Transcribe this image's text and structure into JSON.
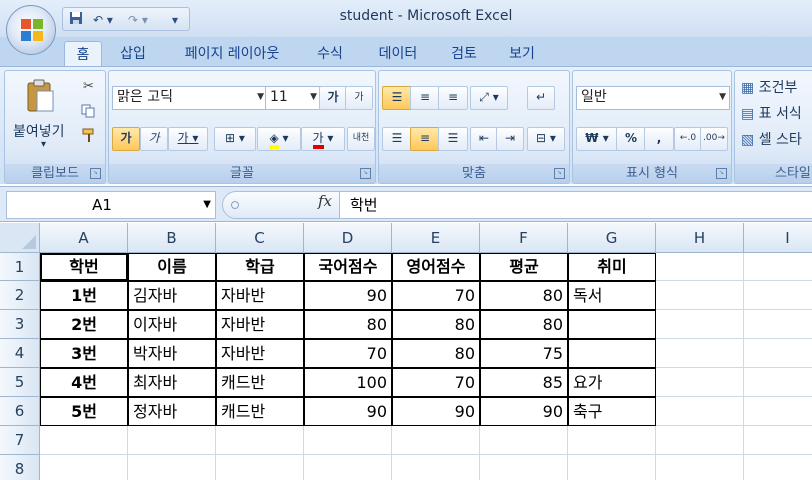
{
  "window": {
    "title": "student - Microsoft Excel"
  },
  "ribbon": {
    "tabs": [
      "홈",
      "삽입",
      "페이지 레이아웃",
      "수식",
      "데이터",
      "검토",
      "보기"
    ],
    "active_tab": "홈",
    "clipboard": {
      "paste_label": "붙여넣기",
      "group_label": "클립보드"
    },
    "font": {
      "name": "맑은 고딕",
      "size": "11",
      "group_label": "글꼴",
      "bold": "가",
      "italic": "가",
      "underline": "가",
      "grow": "가",
      "shrink": "가",
      "color_letter": "가",
      "phonetic": "내천"
    },
    "alignment": {
      "group_label": "맞춤"
    },
    "number": {
      "format": "일반",
      "group_label": "표시 형식",
      "currency": "₩",
      "percent": "%",
      "comma": ","
    },
    "styles": {
      "items": [
        "조건부",
        "표 서식",
        "셀 스타"
      ],
      "group_label": "스타일"
    }
  },
  "formula_bar": {
    "name_box": "A1",
    "fx": "fx",
    "content": "학번"
  },
  "sheet": {
    "columns": [
      "A",
      "B",
      "C",
      "D",
      "E",
      "F",
      "G",
      "H",
      "I"
    ],
    "rows": [
      "1",
      "2",
      "3",
      "4",
      "5",
      "6",
      "7",
      "8"
    ],
    "header": [
      "학번",
      "이름",
      "학급",
      "국어점수",
      "영어점수",
      "평균",
      "취미"
    ],
    "data": [
      [
        "1번",
        "김자바",
        "자바반",
        "90",
        "70",
        "80",
        "독서"
      ],
      [
        "2번",
        "이자바",
        "자바반",
        "80",
        "80",
        "80",
        ""
      ],
      [
        "3번",
        "박자바",
        "자바반",
        "70",
        "80",
        "75",
        ""
      ],
      [
        "4번",
        "최자바",
        "캐드반",
        "100",
        "70",
        "85",
        "요가"
      ],
      [
        "5번",
        "정자바",
        "캐드반",
        "90",
        "90",
        "90",
        "축구"
      ]
    ]
  }
}
